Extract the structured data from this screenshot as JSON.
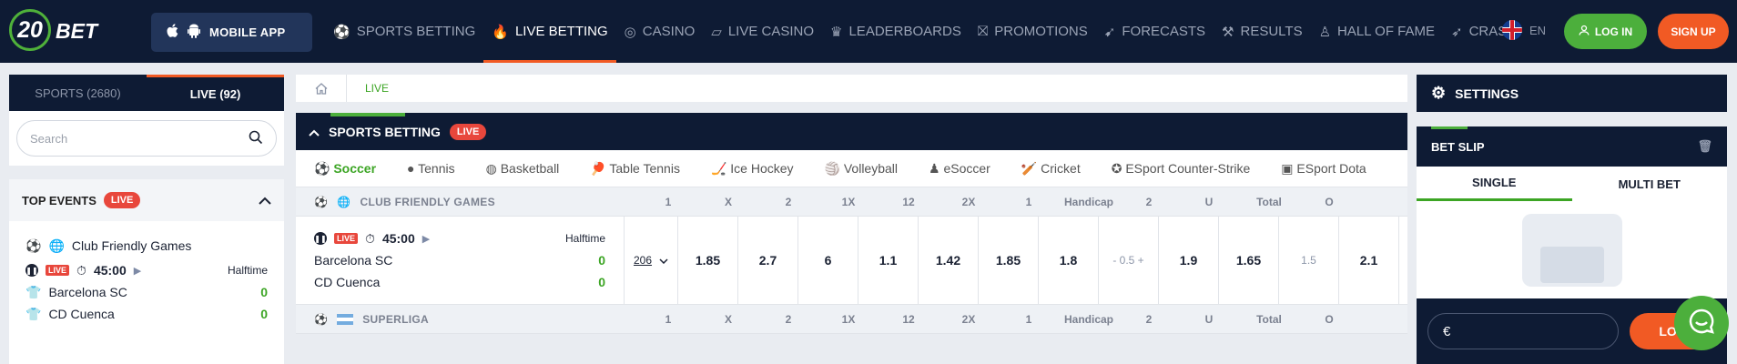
{
  "header": {
    "logo_num": "20",
    "logo_text": "BET",
    "mobile_app": "MOBILE APP",
    "nav": [
      {
        "label": "SPORTS BETTING",
        "icon": "ball-icon"
      },
      {
        "label": "LIVE BETTING",
        "icon": "flame-icon"
      },
      {
        "label": "CASINO",
        "icon": "chip-icon"
      },
      {
        "label": "LIVE CASINO",
        "icon": "card-icon"
      },
      {
        "label": "LEADERBOARDS",
        "icon": "trophy-icon"
      },
      {
        "label": "PROMOTIONS",
        "icon": "gift-icon"
      },
      {
        "label": "FORECASTS",
        "icon": "cursor-icon"
      },
      {
        "label": "RESULTS",
        "icon": "tools-icon"
      },
      {
        "label": "HALL OF FAME",
        "icon": "person-icon"
      },
      {
        "label": "CRASH",
        "icon": "rocket-icon"
      }
    ],
    "lang": "EN",
    "login": "LOG IN",
    "signup": "SIGN UP"
  },
  "left": {
    "tab_sports": "SPORTS (2680)",
    "tab_live": "LIVE (92)",
    "search_placeholder": "Search",
    "top_events": "TOP EVENTS",
    "live": "LIVE",
    "league": "Club Friendly Games",
    "time": "45:00",
    "status": "Halftime",
    "team1": "Barcelona SC",
    "team2": "CD Cuenca",
    "score1": "0",
    "score2": "0"
  },
  "center": {
    "crumb": "LIVE",
    "sb_title": "SPORTS BETTING",
    "sb_live": "LIVE",
    "sports": [
      "Soccer",
      "Tennis",
      "Basketball",
      "Table Tennis",
      "Ice Hockey",
      "Volleyball",
      "eSoccer",
      "Cricket",
      "ESport Counter-Strike",
      "ESport Dota"
    ],
    "columns": [
      "1",
      "X",
      "2",
      "1X",
      "12",
      "2X",
      "1",
      "Handicap",
      "2",
      "U",
      "Total",
      "O"
    ],
    "league1": "CLUB FRIENDLY GAMES",
    "league2": "SUPERLIGA",
    "match": {
      "live": "LIVE",
      "time": "45:00",
      "status": "Halftime",
      "team1": "Barcelona SC",
      "team2": "CD Cuenca",
      "score1": "0",
      "score2": "0",
      "bets": "206",
      "odds": [
        "1.85",
        "2.7",
        "6",
        "1.1",
        "1.42",
        "1.85",
        "1.8",
        "- 0.5 +",
        "1.9",
        "1.65",
        "1.5",
        "2.1"
      ]
    }
  },
  "right": {
    "settings": "SETTINGS",
    "betslip": "BET SLIP",
    "single": "SINGLE",
    "multi": "MULTI BET",
    "currency": "€",
    "login_btn": "LOG"
  }
}
